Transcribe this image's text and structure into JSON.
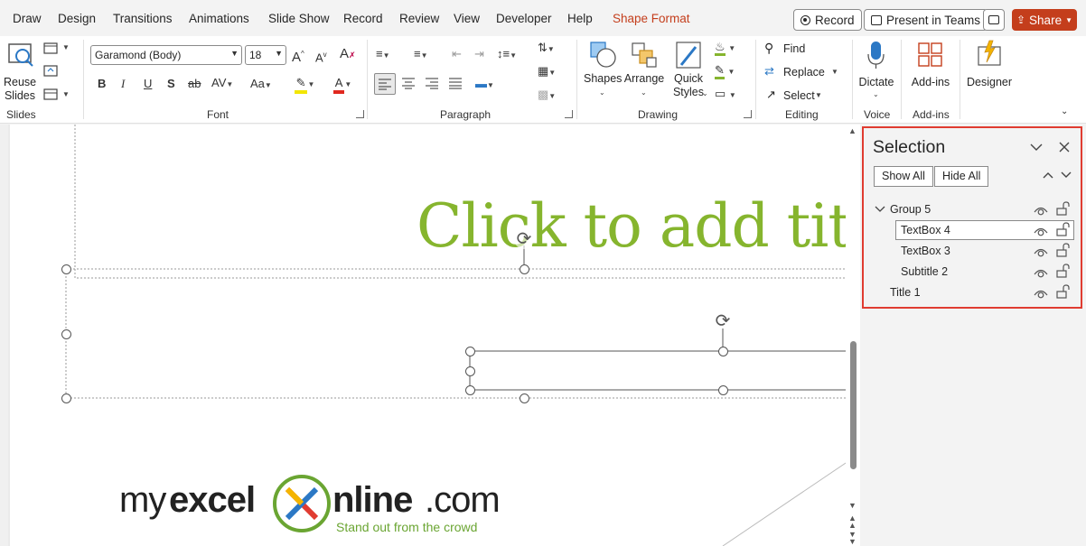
{
  "tabs": [
    {
      "label": "Draw"
    },
    {
      "label": "Design"
    },
    {
      "label": "Transitions"
    },
    {
      "label": "Animations"
    },
    {
      "label": "Slide Show"
    },
    {
      "label": "Record"
    },
    {
      "label": "Review"
    },
    {
      "label": "View"
    },
    {
      "label": "Developer"
    },
    {
      "label": "Help"
    },
    {
      "label": "Shape Format"
    }
  ],
  "topbar": {
    "record_label": "Record",
    "present_label": "Present in Teams",
    "share_label": "Share"
  },
  "ribbon": {
    "slides": {
      "reuse_label": "Reuse\nSlides",
      "group_label": "Slides"
    },
    "font": {
      "font_name": "Garamond (Body)",
      "font_size": "18",
      "group_label": "Font"
    },
    "paragraph": {
      "group_label": "Paragraph"
    },
    "drawing": {
      "shapes_label": "Shapes",
      "arrange_label": "Arrange",
      "quick_styles_label": "Quick\nStyles",
      "group_label": "Drawing"
    },
    "editing": {
      "find_label": "Find",
      "replace_label": "Replace",
      "select_label": "Select",
      "group_label": "Editing"
    },
    "voice": {
      "dictate_label": "Dictate",
      "group_label": "Voice"
    },
    "addins": {
      "addins_label": "Add-ins",
      "group_label": "Add-ins"
    },
    "designer": {
      "designer_label": "Designer"
    }
  },
  "slide": {
    "title_placeholder": "Click to add title",
    "logo": {
      "my": "my",
      "excel": "excel",
      "nline": "nline",
      "com": ".com",
      "tagline": "Stand out from the crowd"
    }
  },
  "selection_pane": {
    "title": "Selection",
    "show_all": "Show All",
    "hide_all": "Hide All",
    "items": [
      {
        "label": "Group 5"
      },
      {
        "label": "TextBox 4"
      },
      {
        "label": "TextBox 3"
      },
      {
        "label": "Subtitle 2"
      },
      {
        "label": "Title 1"
      }
    ]
  },
  "colors": {
    "accent": "#c43e1c",
    "title_green": "#86b52e",
    "highlight_border": "#e03c31"
  }
}
